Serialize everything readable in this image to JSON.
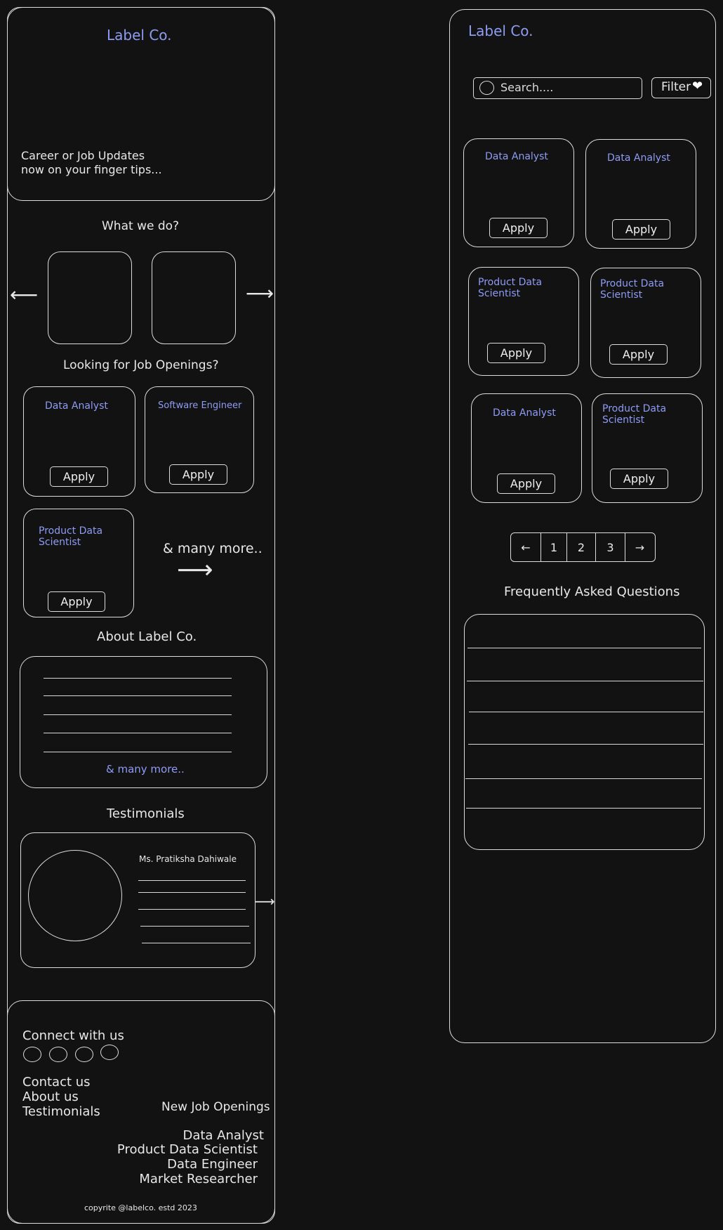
{
  "brand": {
    "logo": "Label Co."
  },
  "home": {
    "hero_tagline_1": "Career or Job Updates",
    "hero_tagline_2": "now on your finger tips...",
    "what_we_do_heading": "What we do?",
    "jobs_heading": "Looking for Job Openings?",
    "job_cards": [
      {
        "title": "Data Analyst",
        "button": "Apply"
      },
      {
        "title": "Software Engineer",
        "button": "Apply"
      },
      {
        "title_line1": "Product Data",
        "title_line2": "Scientist",
        "button": "Apply"
      }
    ],
    "many_more": "& many more..",
    "about_heading": "About Label Co.",
    "about_more": "& many more..",
    "testimonials_heading": "Testimonials",
    "testimonial_name": "Ms. Pratiksha Dahiwale"
  },
  "footer": {
    "connect": "Connect with us",
    "links": [
      "Contact us",
      "About us",
      "Testimonials"
    ],
    "new_jobs_heading": "New Job Openings",
    "new_jobs": [
      "Data Analyst",
      "Product Data Scientist",
      "Data Engineer",
      "Market Researcher"
    ],
    "copyright": "copyrite @labelco. estd 2023"
  },
  "listing": {
    "search_placeholder": "Search....",
    "filter_label": "Filter",
    "cards": [
      {
        "title": "Data Analyst",
        "button": "Apply"
      },
      {
        "title": "Data Analyst",
        "button": "Apply"
      },
      {
        "title_line1": "Product Data",
        "title_line2": "Scientist",
        "button": "Apply"
      },
      {
        "title_line1": "Product Data",
        "title_line2": "Scientist",
        "button": "Apply"
      },
      {
        "title": "Data Analyst",
        "button": "Apply"
      },
      {
        "title_line1": "Product Data",
        "title_line2": "Scientist",
        "button": "Apply"
      }
    ],
    "pagination": {
      "prev": "←",
      "pages": [
        "1",
        "2",
        "3"
      ],
      "next": "→"
    },
    "faq_heading": "Frequently Asked Questions"
  }
}
